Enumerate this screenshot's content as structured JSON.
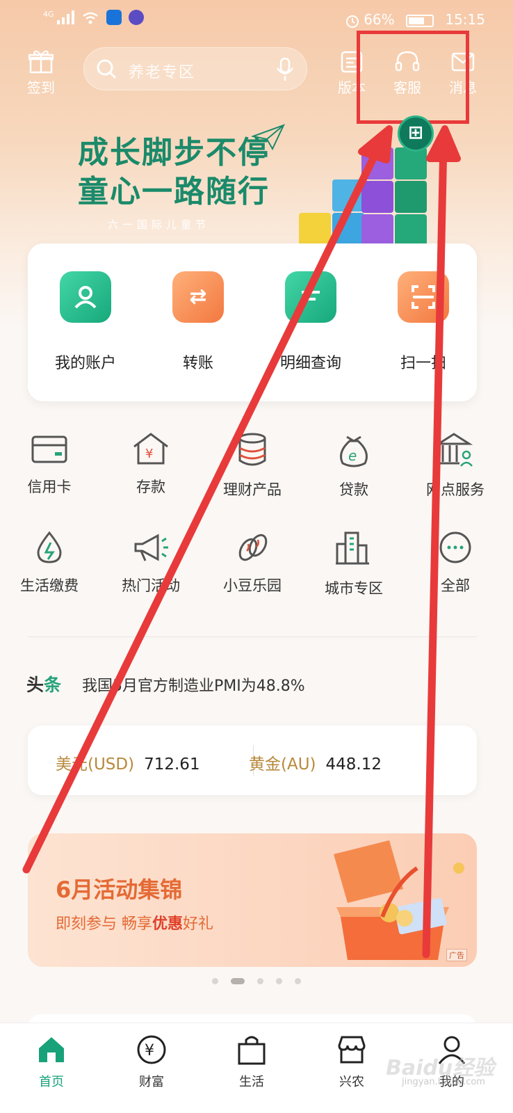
{
  "status_bar": {
    "network": "4G",
    "battery": "66%",
    "time": "15:15"
  },
  "header": {
    "checkin_label": "签到",
    "search_placeholder": "养老专区",
    "version_label": "版本",
    "service_label": "客服",
    "message_label": "消息"
  },
  "banner": {
    "line1": "成长脚步不停",
    "line2": "童心一路随行",
    "subtitle": "六一国际儿童节"
  },
  "quick_actions": [
    {
      "label": "我的账户",
      "icon": "account-icon"
    },
    {
      "label": "转账",
      "icon": "transfer-icon"
    },
    {
      "label": "明细查询",
      "icon": "details-icon"
    },
    {
      "label": "扫一扫",
      "icon": "scan-icon"
    }
  ],
  "services": [
    {
      "label": "信用卡",
      "icon": "credit-card-icon"
    },
    {
      "label": "存款",
      "icon": "deposit-icon"
    },
    {
      "label": "理财产品",
      "icon": "wealth-products-icon"
    },
    {
      "label": "贷款",
      "icon": "loan-icon"
    },
    {
      "label": "网点服务",
      "icon": "branch-service-icon"
    },
    {
      "label": "生活缴费",
      "icon": "bill-payment-icon"
    },
    {
      "label": "热门活动",
      "icon": "megaphone-icon"
    },
    {
      "label": "小豆乐园",
      "icon": "bean-icon"
    },
    {
      "label": "城市专区",
      "icon": "city-icon"
    },
    {
      "label": "全部",
      "icon": "more-icon"
    }
  ],
  "news": {
    "tag_main": "头",
    "tag_accent": "条",
    "headline": "我国5月官方制造业PMI为48.8%"
  },
  "rates": [
    {
      "name": "美元(USD)",
      "value": "712.61"
    },
    {
      "name": "黄金(AU)",
      "value": "448.12"
    }
  ],
  "promo": {
    "title": "6月活动集锦",
    "sub_prefix": "即刻参与  畅享",
    "sub_bold": "优惠",
    "sub_suffix": "好礼",
    "ad_tag": "广告"
  },
  "carousel": {
    "count": 5,
    "active": 1
  },
  "tabs": [
    {
      "label": "首页",
      "icon": "home-icon"
    },
    {
      "label": "财富",
      "icon": "wealth-icon"
    },
    {
      "label": "生活",
      "icon": "shopping-bag-icon"
    },
    {
      "label": "兴农",
      "icon": "store-icon"
    },
    {
      "label": "我的",
      "icon": "profile-icon"
    }
  ],
  "watermark": {
    "main": "Baidu经验",
    "sub": "jingyan.baidu.com"
  },
  "colors": {
    "brand_green": "#19a27a",
    "annotation_red": "#e83a3a",
    "promo_orange": "#e46a35",
    "rate_gold": "#b8893c"
  }
}
